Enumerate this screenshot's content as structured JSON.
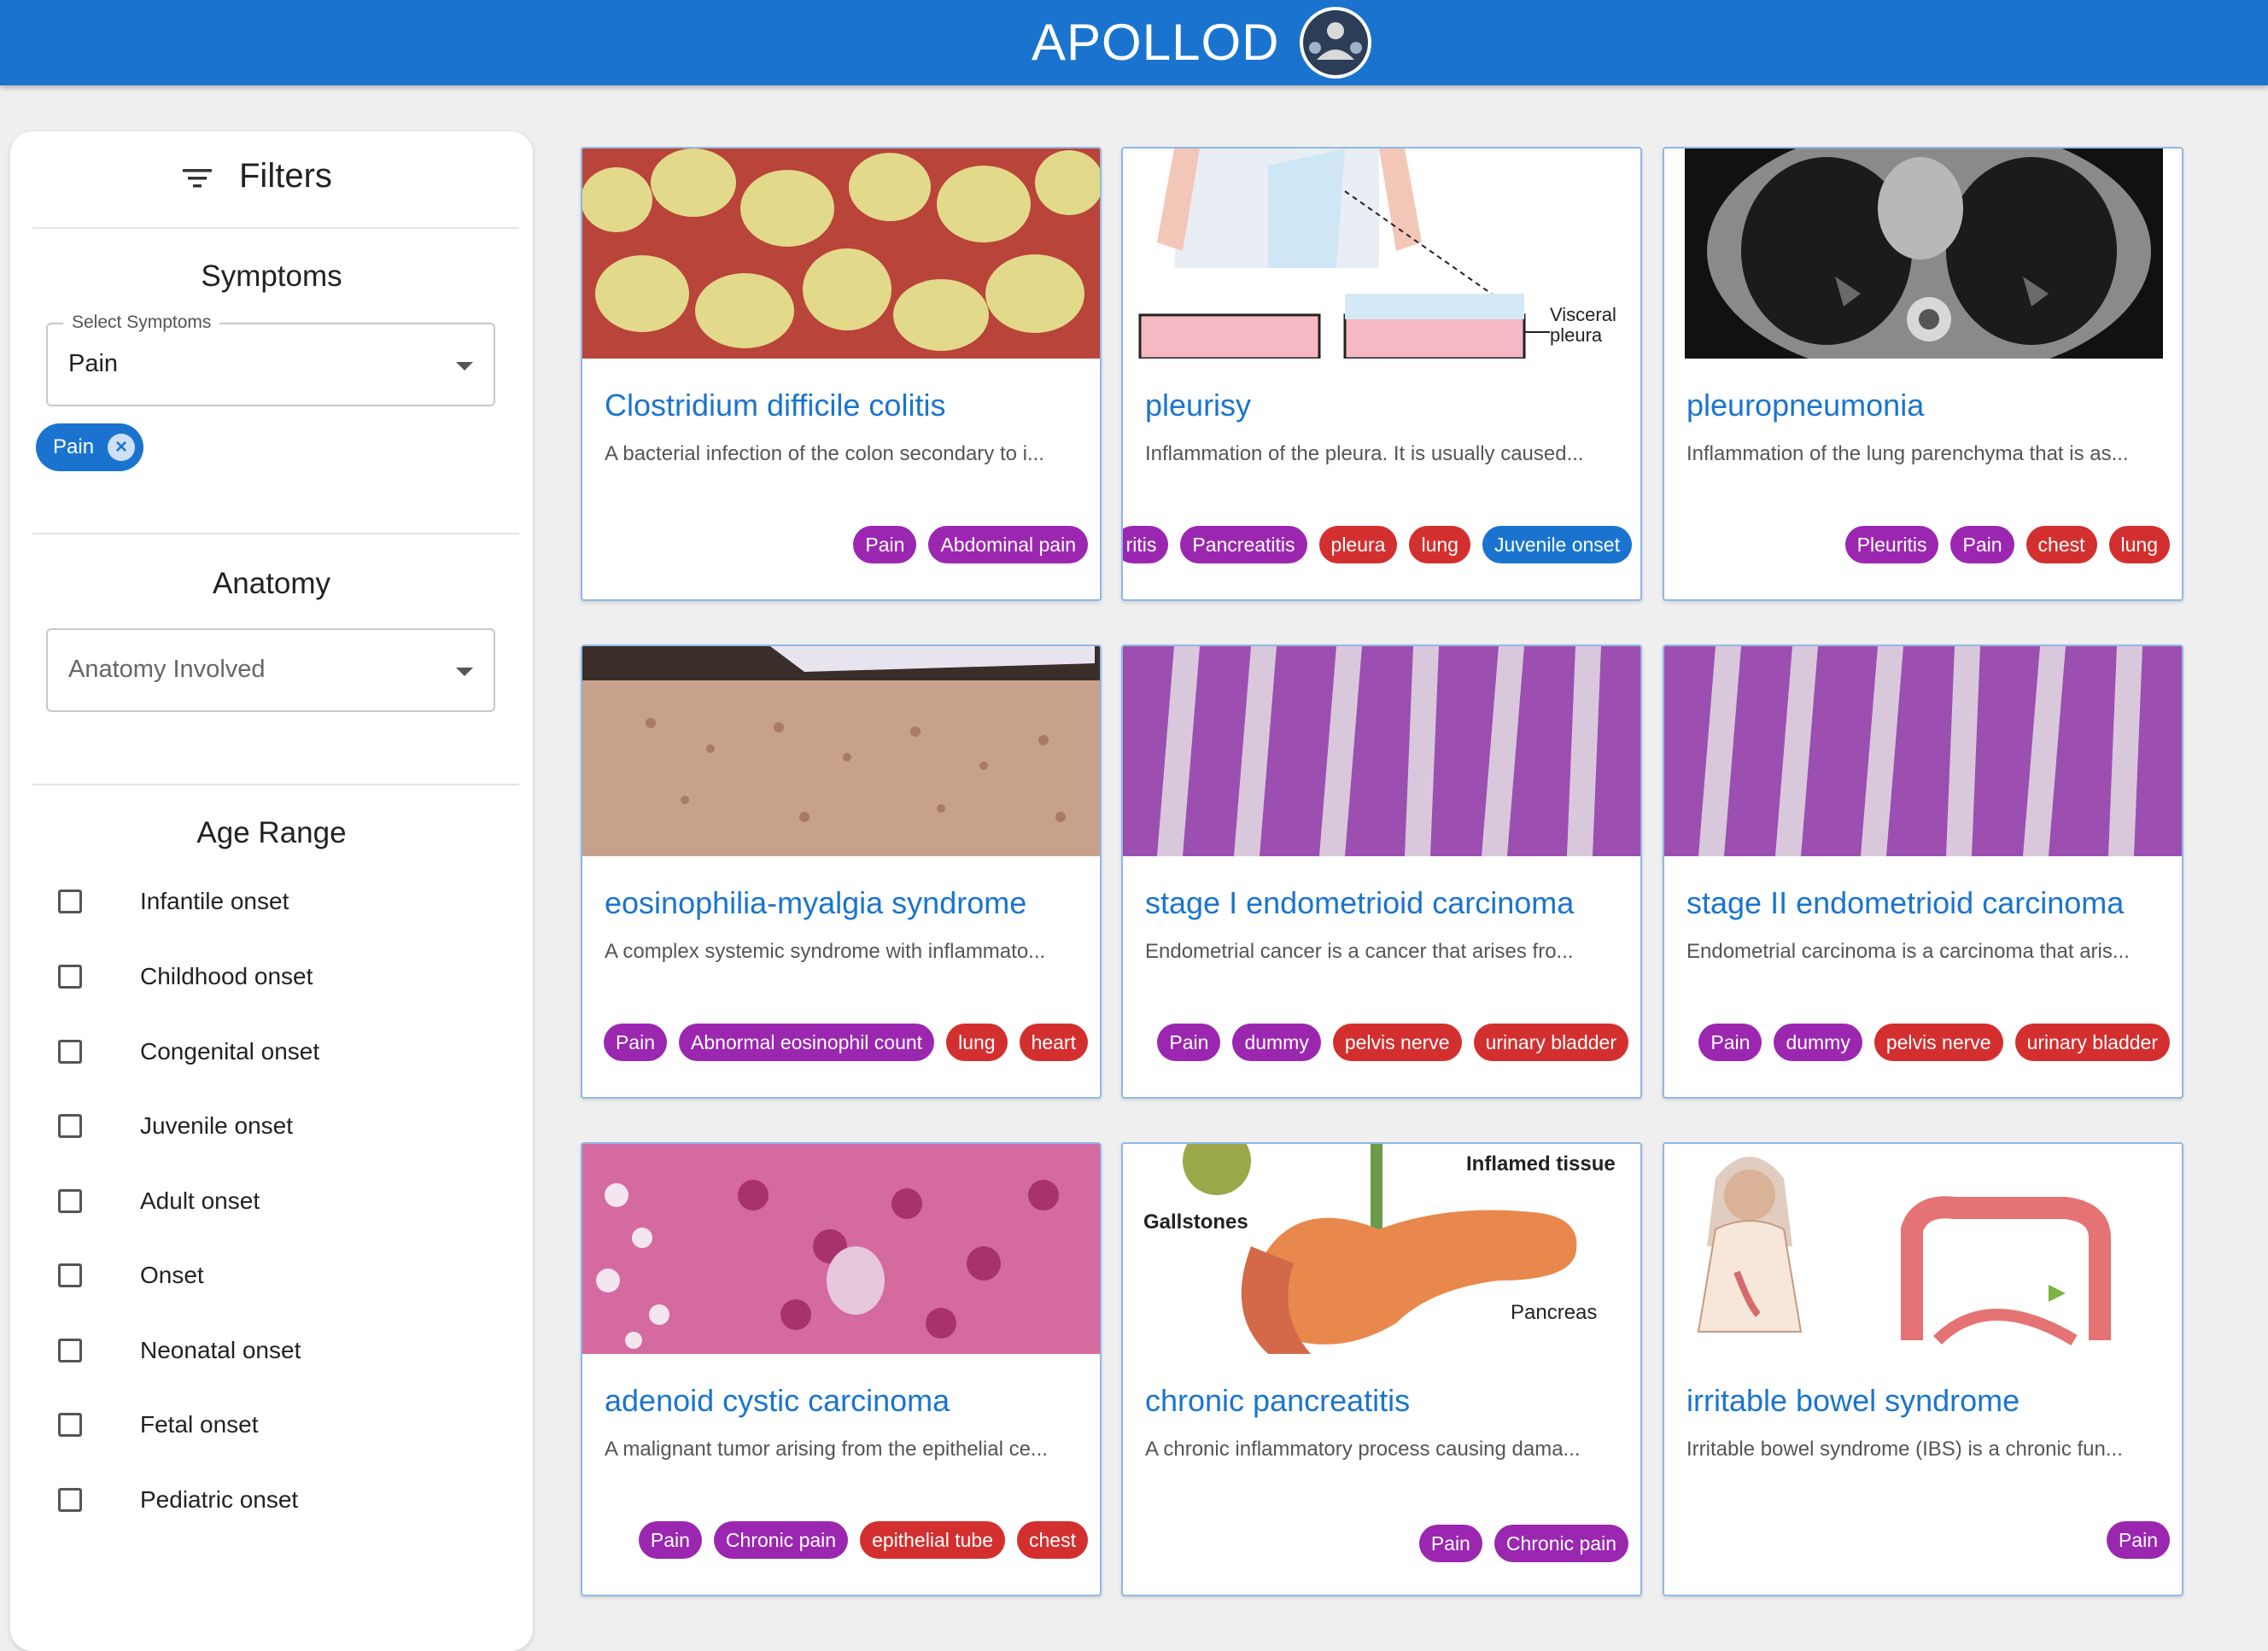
{
  "app": {
    "title": "APOLLOD"
  },
  "filters": {
    "title": "Filters",
    "symptoms": {
      "heading": "Symptoms",
      "select_label": "Select Symptoms",
      "select_value": "Pain",
      "chips": [
        "Pain"
      ]
    },
    "anatomy": {
      "heading": "Anatomy",
      "placeholder": "Anatomy Involved"
    },
    "age_range": {
      "heading": "Age Range",
      "options": [
        "Infantile onset",
        "Childhood onset",
        "Congenital onset",
        "Juvenile onset",
        "Adult onset",
        "Onset",
        "Neonatal onset",
        "Fetal onset",
        "Pediatric onset"
      ]
    }
  },
  "cards": [
    {
      "title": "Clostridium difficile colitis",
      "description": "A bacterial infection of the colon secondary to i...",
      "image": "colitis-photo",
      "tags": [
        {
          "label": "Pain",
          "color": "purple"
        },
        {
          "label": "Abdominal pain",
          "color": "purple"
        }
      ]
    },
    {
      "title": "pleurisy",
      "description": "Inflammation of the pleura. It is usually caused...",
      "image": "pleura-illustration",
      "image_labels": [
        "Visceral",
        "pleura"
      ],
      "tags": [
        {
          "label": "ritis",
          "color": "purple"
        },
        {
          "label": "Pancreatitis",
          "color": "purple"
        },
        {
          "label": "pleura",
          "color": "red"
        },
        {
          "label": "lung",
          "color": "red"
        },
        {
          "label": "Juvenile onset",
          "color": "blue"
        }
      ]
    },
    {
      "title": "pleuropneumonia",
      "description": "Inflammation of the lung parenchyma that is as...",
      "image": "chest-ct-scan",
      "tags": [
        {
          "label": "Pleuritis",
          "color": "purple"
        },
        {
          "label": "Pain",
          "color": "purple"
        },
        {
          "label": "chest",
          "color": "red"
        },
        {
          "label": "lung",
          "color": "red"
        }
      ]
    },
    {
      "title": "eosinophilia-myalgia syndrome",
      "description": "A complex systemic syndrome with inflammato...",
      "image": "skin-photo",
      "tags": [
        {
          "label": "Pain",
          "color": "purple"
        },
        {
          "label": "Abnormal eosinophil count",
          "color": "purple"
        },
        {
          "label": "lung",
          "color": "red"
        },
        {
          "label": "heart",
          "color": "red"
        }
      ]
    },
    {
      "title": "stage I endometrioid carcinoma",
      "description": "Endometrial cancer is a cancer that arises fro...",
      "image": "histology-purple",
      "tags": [
        {
          "label": "Pain",
          "color": "purple"
        },
        {
          "label": "dummy",
          "color": "purple"
        },
        {
          "label": "pelvis nerve",
          "color": "red"
        },
        {
          "label": "urinary bladder",
          "color": "red"
        }
      ]
    },
    {
      "title": "stage II endometrioid carcinoma",
      "description": "Endometrial carcinoma is a carcinoma that aris...",
      "image": "histology-purple",
      "tags": [
        {
          "label": "Pain",
          "color": "purple"
        },
        {
          "label": "dummy",
          "color": "purple"
        },
        {
          "label": "pelvis nerve",
          "color": "red"
        },
        {
          "label": "urinary bladder",
          "color": "red"
        }
      ]
    },
    {
      "title": "adenoid cystic carcinoma",
      "description": "A malignant tumor arising from the epithelial ce...",
      "image": "histology-pink",
      "tags": [
        {
          "label": "Pain",
          "color": "purple"
        },
        {
          "label": "Chronic pain",
          "color": "purple"
        },
        {
          "label": "epithelial tube",
          "color": "red"
        },
        {
          "label": "chest",
          "color": "red"
        }
      ]
    },
    {
      "title": "chronic pancreatitis",
      "description": "A chronic inflammatory process causing dama...",
      "image": "pancreas-illustration",
      "image_labels": [
        "Inflamed tissue",
        "Gallstones",
        "Pancreas"
      ],
      "tags": [
        {
          "label": "Pain",
          "color": "purple"
        },
        {
          "label": "Chronic pain",
          "color": "purple"
        }
      ]
    },
    {
      "title": "irritable bowel syndrome",
      "description": "Irritable bowel syndrome (IBS) is a chronic fun...",
      "image": "colon-illustration",
      "tags": [
        {
          "label": "Pain",
          "color": "purple"
        }
      ]
    }
  ]
}
